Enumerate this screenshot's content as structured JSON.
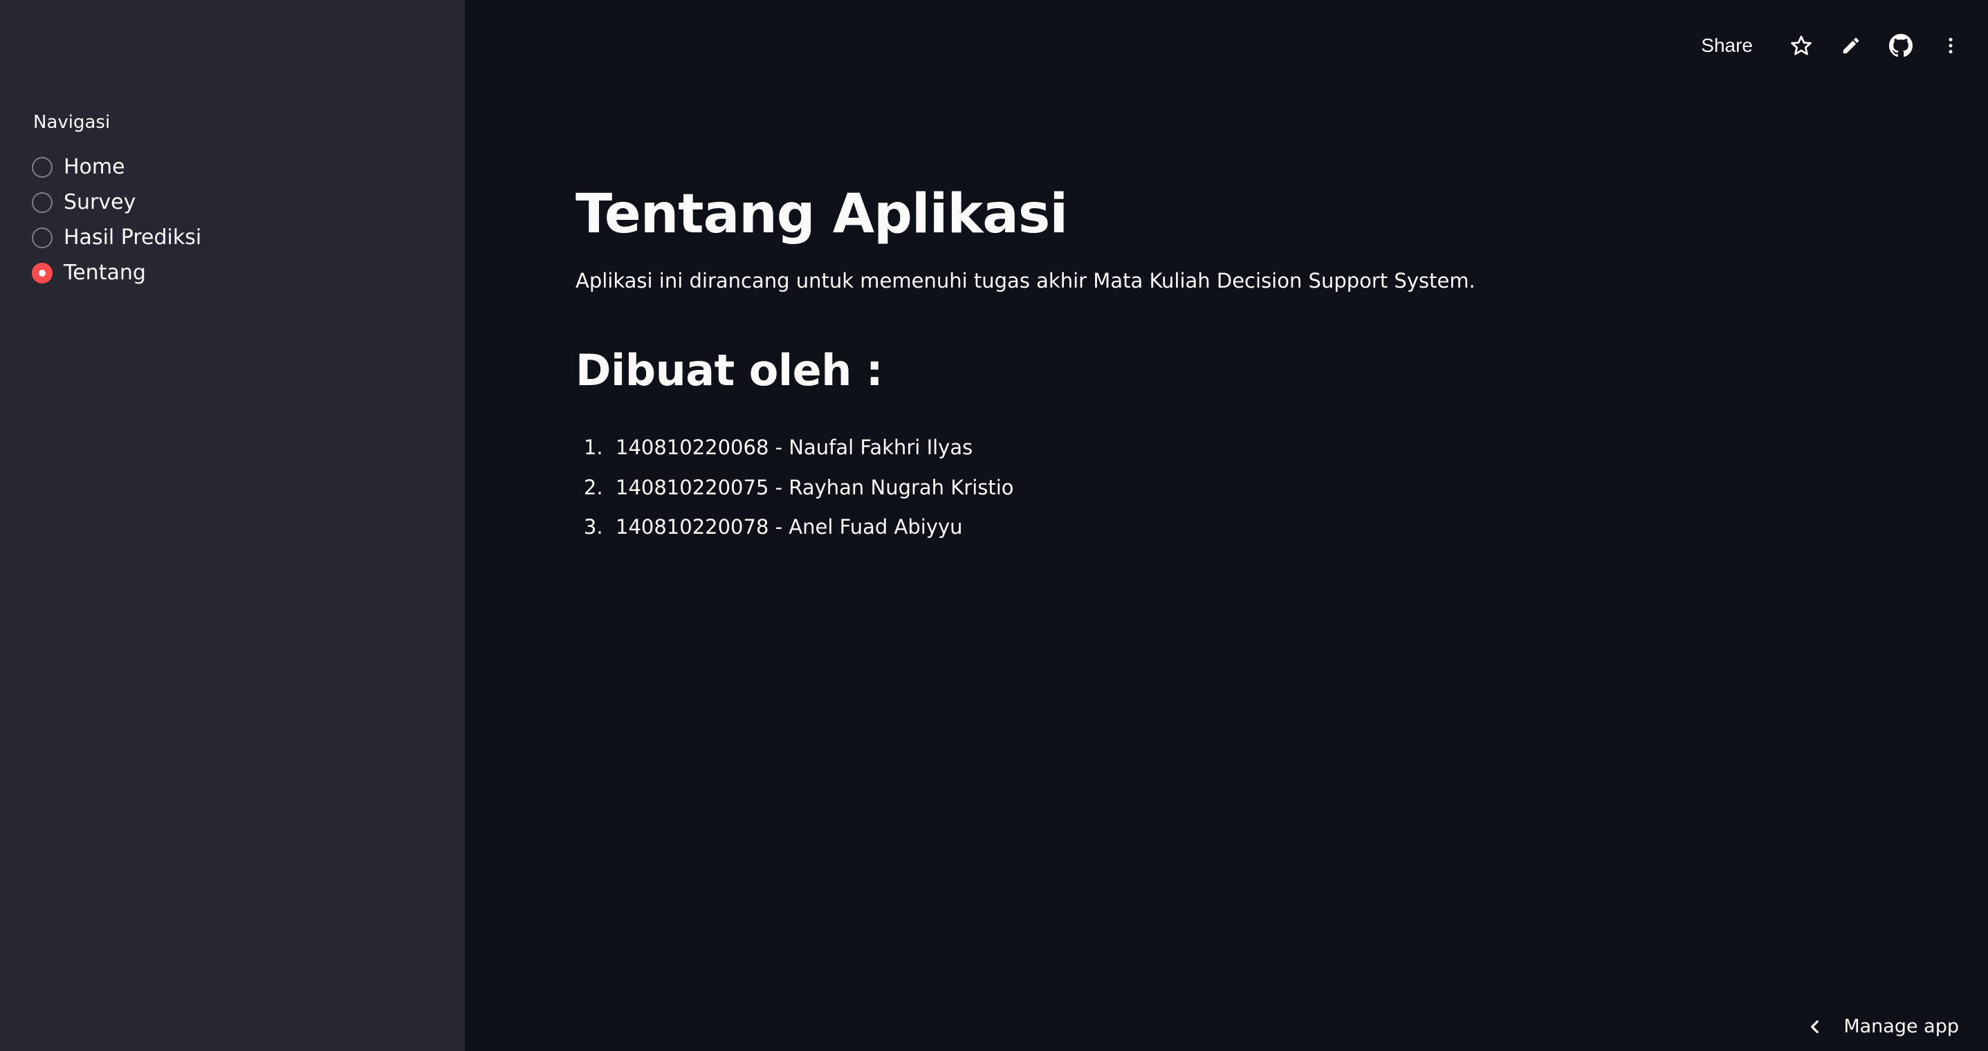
{
  "sidebar": {
    "nav_label": "Navigasi",
    "items": [
      {
        "label": "Home",
        "checked": false
      },
      {
        "label": "Survey",
        "checked": false
      },
      {
        "label": "Hasil Prediksi",
        "checked": false
      },
      {
        "label": "Tentang",
        "checked": true
      }
    ]
  },
  "toolbar": {
    "share_label": "Share",
    "icons": [
      "star-icon",
      "pencil-icon",
      "github-icon",
      "kebab-menu-icon"
    ]
  },
  "main": {
    "title": "Tentang Aplikasi",
    "description": "Aplikasi ini dirancang untuk memenuhi tugas akhir Mata Kuliah Decision Support System.",
    "subheading": "Dibuat oleh :",
    "authors": [
      {
        "num": "1.",
        "text": "140810220068 - Naufal Fakhri Ilyas"
      },
      {
        "num": "2.",
        "text": "140810220075 - Rayhan Nugrah Kristio"
      },
      {
        "num": "3.",
        "text": "140810220078 - Anel Fuad Abiyyu"
      }
    ]
  },
  "footer": {
    "manage_label": "Manage app"
  },
  "colors": {
    "main_bg": "#0e1117",
    "sidebar_bg": "#262730",
    "accent": "#ff4b4b",
    "text": "#fafafa"
  }
}
